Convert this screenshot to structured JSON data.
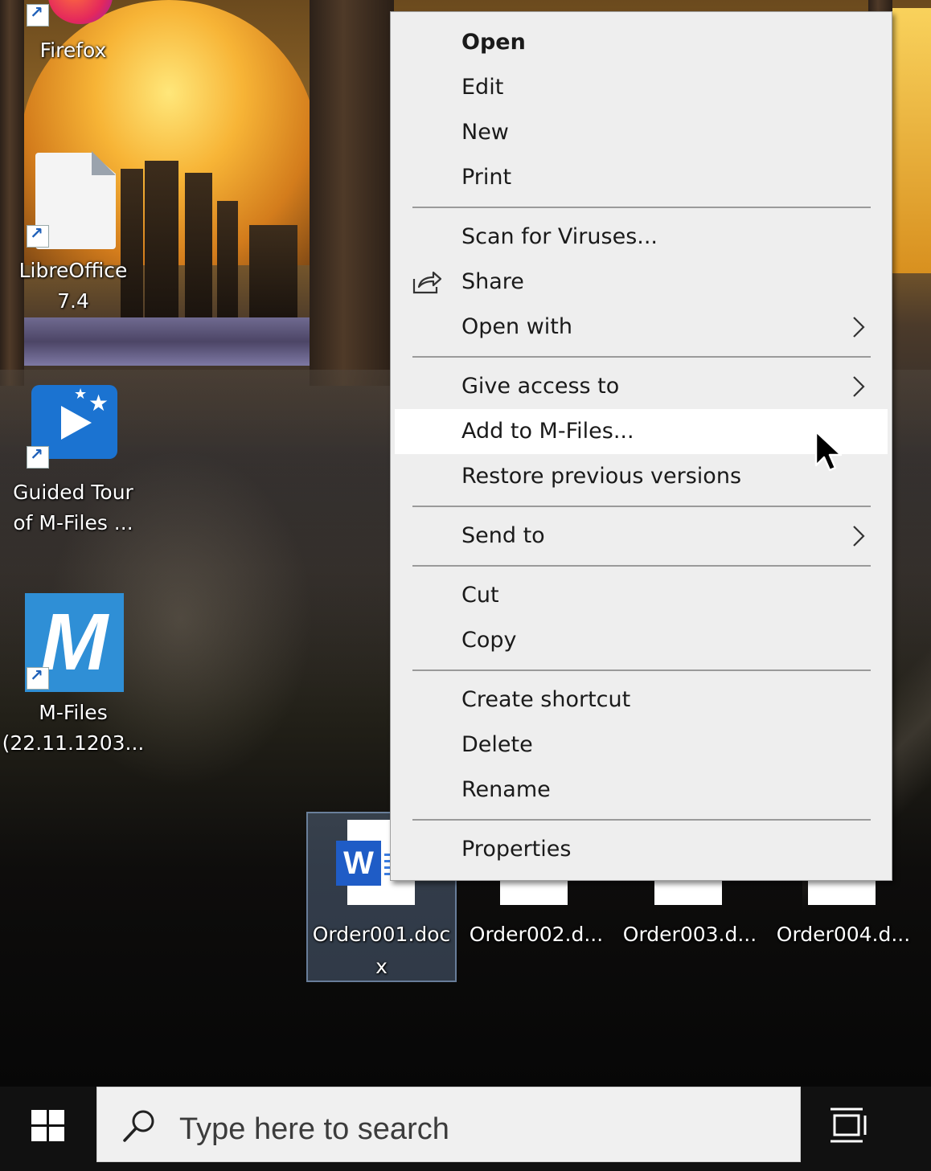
{
  "desktop": {
    "icons": [
      {
        "label_lines": [
          "Firefox"
        ],
        "icon": "firefox-icon"
      },
      {
        "label_lines": [
          "LibreOffice",
          "7.4"
        ],
        "icon": "libreoffice-icon"
      },
      {
        "label_lines": [
          "Guided Tour",
          "of M-Files ..."
        ],
        "icon": "guided-tour-icon"
      },
      {
        "label_lines": [
          "M-Files",
          "(22.11.1203..."
        ],
        "icon": "m-files-icon"
      }
    ],
    "files": [
      {
        "label_lines": [
          "Order001.doc",
          "x"
        ],
        "icon": "word-document-icon",
        "selected": true
      },
      {
        "label_lines": [
          "Order002.d..."
        ],
        "icon": "word-document-icon",
        "selected": false
      },
      {
        "label_lines": [
          "Order003.d..."
        ],
        "icon": "word-document-icon",
        "selected": false
      },
      {
        "label_lines": [
          "Order004.d..."
        ],
        "icon": "word-document-icon",
        "selected": false
      }
    ],
    "word_badge_letter": "W",
    "m_files_letter": "M"
  },
  "context_menu": {
    "items": [
      {
        "label": "Open",
        "bold": true
      },
      {
        "label": "Edit"
      },
      {
        "label": "New"
      },
      {
        "label": "Print"
      },
      {
        "label": "Scan for Viruses..."
      },
      {
        "label": "Share",
        "icon": "share-icon"
      },
      {
        "label": "Open with",
        "submenu": true
      },
      {
        "label": "Give access to",
        "submenu": true
      },
      {
        "label": "Add to M-Files...",
        "hovered": true
      },
      {
        "label": "Restore previous versions"
      },
      {
        "label": "Send to",
        "submenu": true
      },
      {
        "label": "Cut"
      },
      {
        "label": "Copy"
      },
      {
        "label": "Create shortcut"
      },
      {
        "label": "Delete"
      },
      {
        "label": "Rename"
      },
      {
        "label": "Properties"
      }
    ]
  },
  "taskbar": {
    "start_icon": "windows-logo-icon",
    "search_placeholder": "Type here to search",
    "task_view_icon": "task-view-icon"
  },
  "colors": {
    "menu_background": "#eeeeee",
    "menu_hover": "#ffffff",
    "word_blue": "#1f5cc6",
    "m_files_blue": "#2f8fd6",
    "guided_tour_blue": "#1b73d1"
  }
}
